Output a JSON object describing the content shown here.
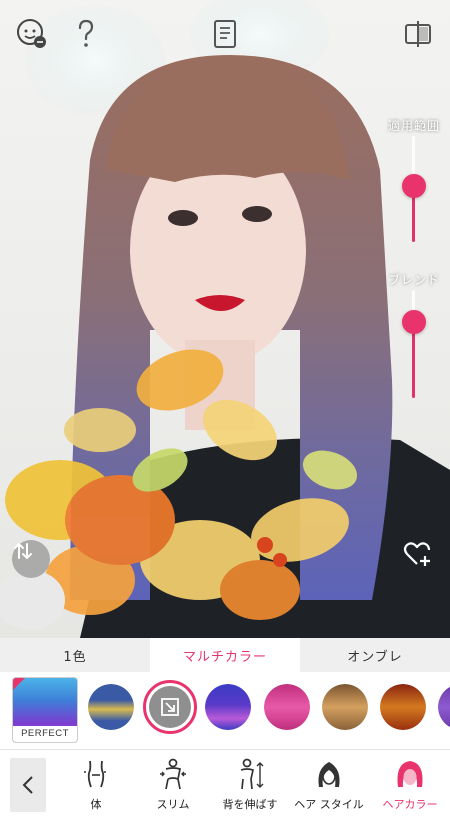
{
  "sliders": {
    "range": {
      "label": "適用範囲",
      "value": 0.55
    },
    "blend": {
      "label": "ブレンド",
      "value": 0.55
    }
  },
  "tabs": [
    {
      "label": "1色",
      "active": false
    },
    {
      "label": "マルチカラー",
      "active": true
    },
    {
      "label": "オンブレ",
      "active": false
    }
  ],
  "perfect": {
    "label": "PERFECT"
  },
  "swatch_colors": [
    "#3b5fa8/#d6b84a",
    "#8a8a8a",
    "#3e3cc8/#b75ad8",
    "#c2307f/#e85aa8",
    "#7a5530/#d4a060",
    "#8a2510/#d47a20",
    "#6a3aa8"
  ],
  "bottom_nav": [
    {
      "label": "体",
      "active": false
    },
    {
      "label": "スリム",
      "active": false
    },
    {
      "label": "背を伸ばす",
      "active": false
    },
    {
      "label": "ヘア スタイル",
      "active": false
    },
    {
      "label": "ヘアカラー",
      "active": true
    }
  ],
  "colors": {
    "accent": "#e8336c"
  },
  "icons": [
    "face-compare-icon",
    "help-icon",
    "document-icon",
    "split-view-icon",
    "swap-icon",
    "heart-plus-icon",
    "chevron-left-icon"
  ]
}
